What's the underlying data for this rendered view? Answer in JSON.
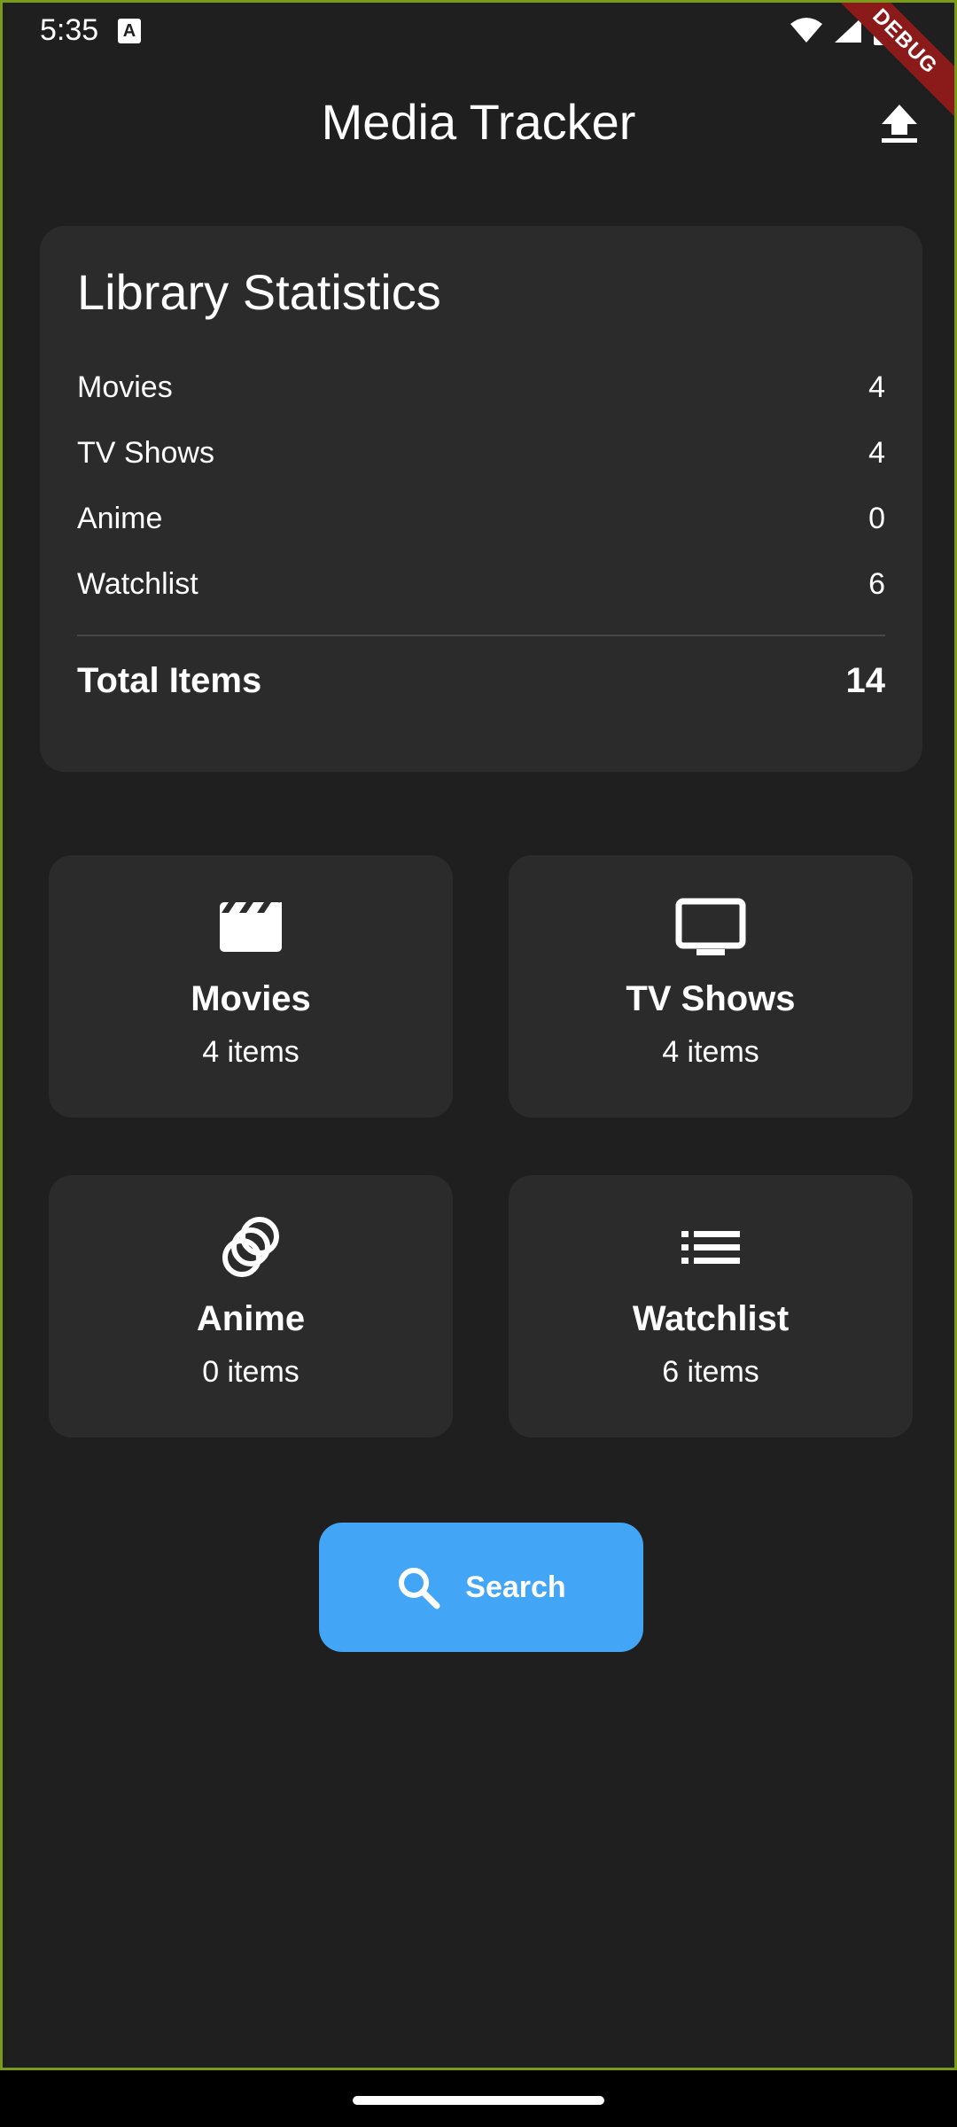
{
  "status_bar": {
    "time": "5:35",
    "notification_glyph": "A",
    "icons": [
      "wifi-icon",
      "signal-icon",
      "battery-icon"
    ]
  },
  "debug_banner": "DEBUG",
  "app_bar": {
    "title": "Media Tracker",
    "action_icon": "upload-icon"
  },
  "stats": {
    "title": "Library Statistics",
    "rows": [
      {
        "label": "Movies",
        "value": "4"
      },
      {
        "label": "TV Shows",
        "value": "4"
      },
      {
        "label": "Anime",
        "value": "0"
      },
      {
        "label": "Watchlist",
        "value": "6"
      }
    ],
    "total_label": "Total Items",
    "total_value": "14"
  },
  "categories": [
    {
      "name": "Movies",
      "count": "4 items",
      "icon": "movie-clapper-icon"
    },
    {
      "name": "TV Shows",
      "count": "4 items",
      "icon": "tv-icon"
    },
    {
      "name": "Anime",
      "count": "0 items",
      "icon": "anime-rings-icon"
    },
    {
      "name": "Watchlist",
      "count": "6 items",
      "icon": "list-icon"
    }
  ],
  "search_button": {
    "label": "Search",
    "icon": "search-icon"
  },
  "colors": {
    "background": "#1f1f1f",
    "card": "#2b2b2b",
    "accent": "#42a5f5",
    "debug_banner": "#8b1a1a"
  }
}
